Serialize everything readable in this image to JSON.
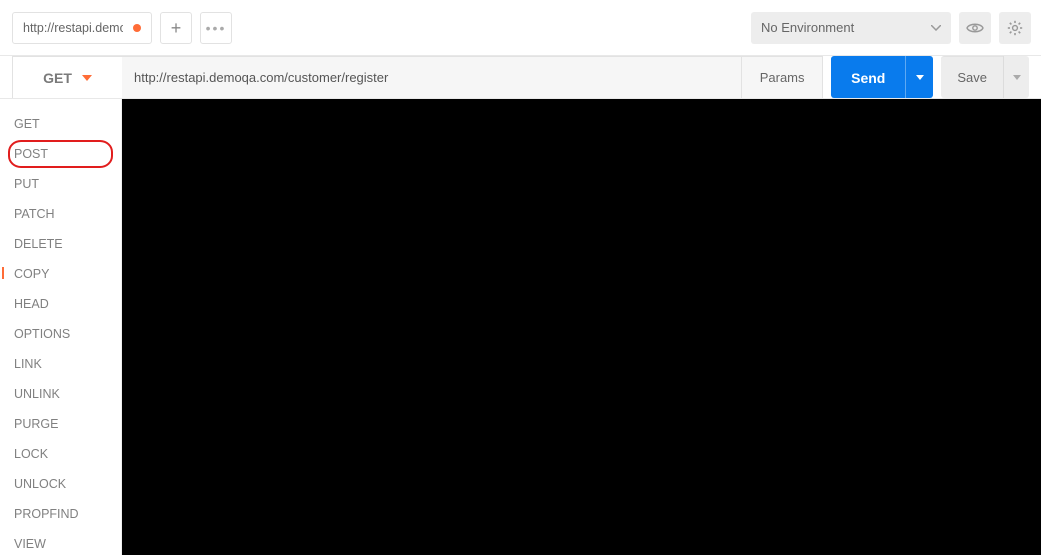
{
  "tabs": {
    "active_title": "http://restapi.demoqa"
  },
  "environment": {
    "selected": "No Environment"
  },
  "request": {
    "method": "GET",
    "url": "http://restapi.demoqa.com/customer/register",
    "params_label": "Params",
    "send_label": "Send",
    "save_label": "Save"
  },
  "method_dropdown": {
    "highlighted_index": 1,
    "items": [
      "GET",
      "POST",
      "PUT",
      "PATCH",
      "DELETE",
      "COPY",
      "HEAD",
      "OPTIONS",
      "LINK",
      "UNLINK",
      "PURGE",
      "LOCK",
      "UNLOCK",
      "PROPFIND",
      "VIEW"
    ]
  }
}
